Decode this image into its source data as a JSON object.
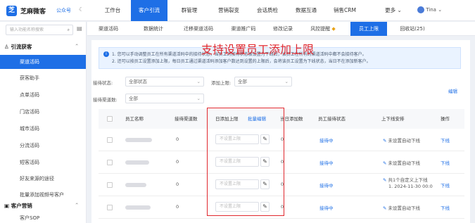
{
  "header": {
    "logo_char": "芝",
    "brand": "芝麻微客",
    "brand_tag": "公众号",
    "nav": [
      {
        "label": "工作台",
        "active": false
      },
      {
        "label": "客户引流",
        "active": true
      },
      {
        "label": "群管理",
        "active": false
      },
      {
        "label": "营销裂变",
        "active": false
      },
      {
        "label": "会话质检",
        "active": false
      },
      {
        "label": "数据互通",
        "active": false
      },
      {
        "label": "销售CRM",
        "active": false
      },
      {
        "label": "更多 ⌄",
        "active": false
      }
    ],
    "user_name": "Tina ⌄"
  },
  "sidebar": {
    "search_placeholder": "输入功能名称搜索",
    "groups": [
      {
        "label": "引流获客"
      },
      {
        "label": "客户营销"
      }
    ],
    "items": [
      {
        "label": "渠道活码",
        "active": true
      },
      {
        "label": "获客助手",
        "active": false
      },
      {
        "label": "点单活码",
        "active": false
      },
      {
        "label": "门店活码",
        "active": false
      },
      {
        "label": "城市活码",
        "active": false
      },
      {
        "label": "分流活码",
        "active": false
      },
      {
        "label": "短客活码",
        "active": false
      },
      {
        "label": "好友来源的途径",
        "active": false
      },
      {
        "label": "批量添加视频号客户",
        "active": false
      }
    ],
    "bottom_item": "客户SOP"
  },
  "tabs": [
    {
      "label": "渠道活码",
      "active": false
    },
    {
      "label": "数据统计",
      "active": false
    },
    {
      "label": "迁移渠道活码",
      "active": false
    },
    {
      "label": "渠道推广码",
      "active": false
    },
    {
      "label": "修改记录",
      "active": false
    },
    {
      "label": "风控提醒",
      "active": false
    },
    {
      "label": "员工上限",
      "active": true
    },
    {
      "label": "回收站(25)",
      "active": false
    }
  ],
  "notice": {
    "line1": "1. 您可以手动调整员工在所有渠道活码中的接待状态，当员工的接待状态被设置为下线后，该员工在所有的渠道活码中都不会接待客户。",
    "line2": "2. 还可以按员工设置添加上限，每日员工通过渠道活码添加客户数达到设置的上限后，会将该员工设置为下线状态，当日不在添加新客户。"
  },
  "filters": {
    "status_label": "接待状态:",
    "status_value": "全部状态",
    "limit_label": "添加上限:",
    "limit_value": "全部",
    "channels_label": "接待渠道数:",
    "channels_value": "全部",
    "edit_action": "编辑"
  },
  "overlay_text": "支持设置员工添加上限",
  "table": {
    "columns": {
      "name": "员工名称",
      "channels": "接待渠道数",
      "daily_limit": "日添加上限",
      "batch_edit": "批量编辑",
      "today_added": "当日添加数",
      "status": "员工接待状态",
      "schedule": "上下线安排",
      "ops": "操作"
    },
    "rows": [
      {
        "channels": "0",
        "placeholder": "不设置上限",
        "today": "0",
        "status": "接待中",
        "schedule": "未设置自动下线",
        "op": "下线"
      },
      {
        "channels": "0",
        "placeholder": "不设置上限",
        "today": "0",
        "status": "接待中",
        "schedule": "未设置自动下线",
        "op": "下线"
      },
      {
        "channels": "0",
        "placeholder": "不设置上限",
        "today": "0",
        "status": "接待中",
        "schedule": "共1个自定义上下线",
        "schedule2": "1. 2024-11-30 00:0",
        "op": "下线"
      },
      {
        "channels": "0",
        "placeholder": "不设置上限",
        "today": "0",
        "status": "接待中",
        "schedule": "未设置自动下线",
        "op": "下线"
      }
    ]
  },
  "colors": {
    "accent": "#1e6fe6",
    "highlight": "#e0282e"
  }
}
